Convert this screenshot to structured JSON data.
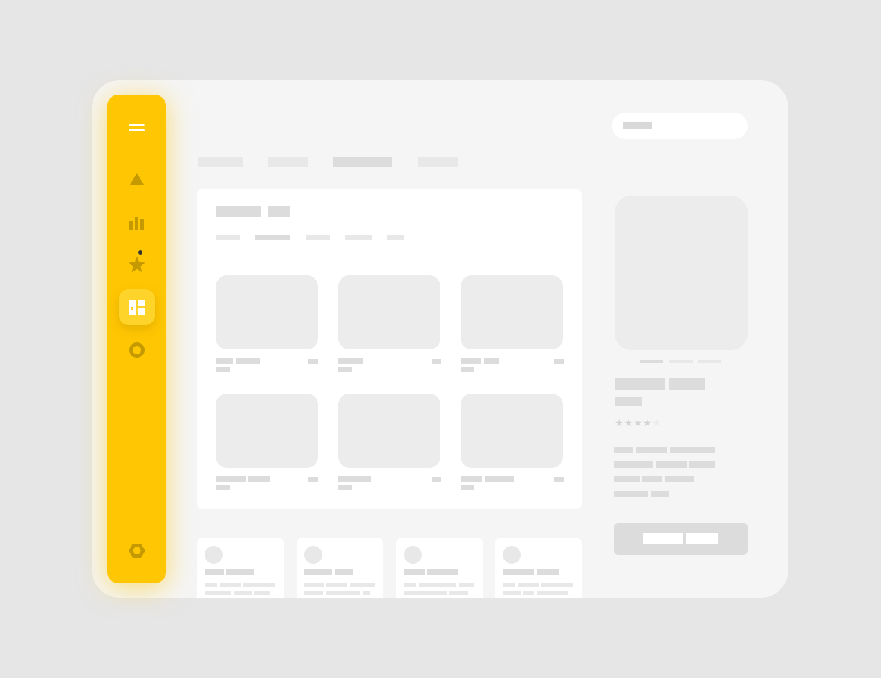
{
  "theme": {
    "accent": "#fec603",
    "accent_active": "#ffd42a",
    "icon_color": "#b28a00",
    "background": "#e6e6e6",
    "window": "#f5f5f5",
    "placeholder": "#dcdcdc"
  },
  "sidebar": {
    "items": [
      {
        "icon": "menu-icon"
      },
      {
        "icon": "triangle-icon"
      },
      {
        "icon": "bar-chart-icon"
      },
      {
        "icon": "star-icon",
        "badge": true
      },
      {
        "icon": "dashboard-icon",
        "active": true
      },
      {
        "icon": "circle-icon"
      },
      {
        "icon": "settings-icon"
      }
    ]
  },
  "tabs": {
    "count": 4,
    "active_index": 2
  },
  "main_card": {
    "filter_count": 5,
    "active_filter_index": 1,
    "grid_tiles": 6
  },
  "feed": {
    "card_count": 4
  },
  "detail": {
    "carousel_pages": 3,
    "active_page": 0,
    "rating": 4,
    "rating_max": 5
  }
}
